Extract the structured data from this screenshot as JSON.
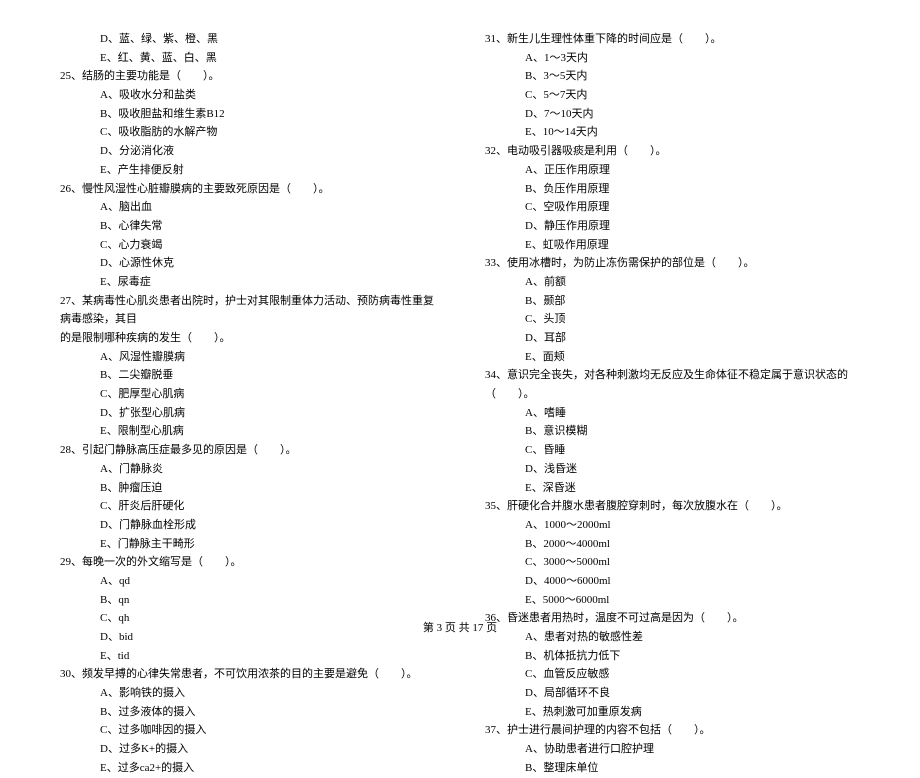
{
  "left_column": [
    {
      "type": "option",
      "text": "D、蓝、绿、紫、橙、黑"
    },
    {
      "type": "option",
      "text": "E、红、黄、蓝、白、黑"
    },
    {
      "type": "question",
      "text": "25、结肠的主要功能是（　　）。"
    },
    {
      "type": "option",
      "text": "A、吸收水分和盐类"
    },
    {
      "type": "option",
      "text": "B、吸收胆盐和维生素B12"
    },
    {
      "type": "option",
      "text": "C、吸收脂肪的水解产物"
    },
    {
      "type": "option",
      "text": "D、分泌消化液"
    },
    {
      "type": "option",
      "text": "E、产生排便反射"
    },
    {
      "type": "question",
      "text": "26、慢性风湿性心脏瓣膜病的主要致死原因是（　　）。"
    },
    {
      "type": "option",
      "text": "A、脑出血"
    },
    {
      "type": "option",
      "text": "B、心律失常"
    },
    {
      "type": "option",
      "text": "C、心力衰竭"
    },
    {
      "type": "option",
      "text": "D、心源性休克"
    },
    {
      "type": "option",
      "text": "E、尿毒症"
    },
    {
      "type": "question",
      "text": "27、某病毒性心肌炎患者出院时，护士对其限制重体力活动、预防病毒性重复病毒感染，其目"
    },
    {
      "type": "continue",
      "text": "的是限制哪种疾病的发生（　　）。"
    },
    {
      "type": "option",
      "text": "A、风湿性瓣膜病"
    },
    {
      "type": "option",
      "text": "B、二尖瓣脱垂"
    },
    {
      "type": "option",
      "text": "C、肥厚型心肌病"
    },
    {
      "type": "option",
      "text": "D、扩张型心肌病"
    },
    {
      "type": "option",
      "text": "E、限制型心肌病"
    },
    {
      "type": "question",
      "text": "28、引起门静脉高压症最多见的原因是（　　）。"
    },
    {
      "type": "option",
      "text": "A、门静脉炎"
    },
    {
      "type": "option",
      "text": "B、肿瘤压迫"
    },
    {
      "type": "option",
      "text": "C、肝炎后肝硬化"
    },
    {
      "type": "option",
      "text": "D、门静脉血栓形成"
    },
    {
      "type": "option",
      "text": "E、门静脉主干畸形"
    },
    {
      "type": "question",
      "text": "29、每晚一次的外文缩写是（　　）。"
    },
    {
      "type": "option",
      "text": "A、qd"
    },
    {
      "type": "option",
      "text": "B、qn"
    },
    {
      "type": "option",
      "text": "C、qh"
    },
    {
      "type": "option",
      "text": "D、bid"
    },
    {
      "type": "option",
      "text": "E、tid"
    },
    {
      "type": "question",
      "text": "30、频发早搏的心律失常患者，不可饮用浓茶的目的主要是避免（　　）。"
    },
    {
      "type": "option",
      "text": "A、影响铁的摄入"
    },
    {
      "type": "option",
      "text": "B、过多液体的摄入"
    },
    {
      "type": "option",
      "text": "C、过多咖啡因的摄入"
    },
    {
      "type": "option",
      "text": "D、过多K+的摄入"
    },
    {
      "type": "option",
      "text": "E、过多ca2+的摄入"
    }
  ],
  "right_column": [
    {
      "type": "question",
      "text": "31、新生儿生理性体重下降的时间应是（　　）。"
    },
    {
      "type": "option",
      "text": "A、1～3天内"
    },
    {
      "type": "option",
      "text": "B、3～5天内"
    },
    {
      "type": "option",
      "text": "C、5～7天内"
    },
    {
      "type": "option",
      "text": "D、7～10天内"
    },
    {
      "type": "option",
      "text": "E、10～14天内"
    },
    {
      "type": "question",
      "text": "32、电动吸引器吸痰是利用（　　）。"
    },
    {
      "type": "option",
      "text": "A、正压作用原理"
    },
    {
      "type": "option",
      "text": "B、负压作用原理"
    },
    {
      "type": "option",
      "text": "C、空吸作用原理"
    },
    {
      "type": "option",
      "text": "D、静压作用原理"
    },
    {
      "type": "option",
      "text": "E、虹吸作用原理"
    },
    {
      "type": "question",
      "text": "33、使用冰槽时，为防止冻伤需保护的部位是（　　）。"
    },
    {
      "type": "option",
      "text": "A、前额"
    },
    {
      "type": "option",
      "text": "B、颞部"
    },
    {
      "type": "option",
      "text": "C、头顶"
    },
    {
      "type": "option",
      "text": "D、耳部"
    },
    {
      "type": "option",
      "text": "E、面颊"
    },
    {
      "type": "question",
      "text": "34、意识完全丧失，对各种刺激均无反应及生命体征不稳定属于意识状态的（　　）。"
    },
    {
      "type": "option",
      "text": "A、嗜睡"
    },
    {
      "type": "option",
      "text": "B、意识模糊"
    },
    {
      "type": "option",
      "text": "C、昏睡"
    },
    {
      "type": "option",
      "text": "D、浅昏迷"
    },
    {
      "type": "option",
      "text": "E、深昏迷"
    },
    {
      "type": "question",
      "text": "35、肝硬化合并腹水患者腹腔穿刺时，每次放腹水在（　　）。"
    },
    {
      "type": "option",
      "text": "A、1000～2000ml"
    },
    {
      "type": "option",
      "text": "B、2000～4000ml"
    },
    {
      "type": "option",
      "text": "C、3000～5000ml"
    },
    {
      "type": "option",
      "text": "D、4000～6000ml"
    },
    {
      "type": "option",
      "text": "E、5000～6000ml"
    },
    {
      "type": "question",
      "text": "36、昏迷患者用热时，温度不可过高是因为（　　）。"
    },
    {
      "type": "option",
      "text": "A、患者对热的敏感性差"
    },
    {
      "type": "option",
      "text": "B、机体抵抗力低下"
    },
    {
      "type": "option",
      "text": "C、血管反应敏感"
    },
    {
      "type": "option",
      "text": "D、局部循环不良"
    },
    {
      "type": "option",
      "text": "E、热刺激可加重原发病"
    },
    {
      "type": "question",
      "text": "37、护士进行晨间护理的内容不包括（　　）。"
    },
    {
      "type": "option",
      "text": "A、协助患者进行口腔护理"
    },
    {
      "type": "option",
      "text": "B、整理床单位"
    }
  ],
  "footer": "第 3 页 共 17 页"
}
